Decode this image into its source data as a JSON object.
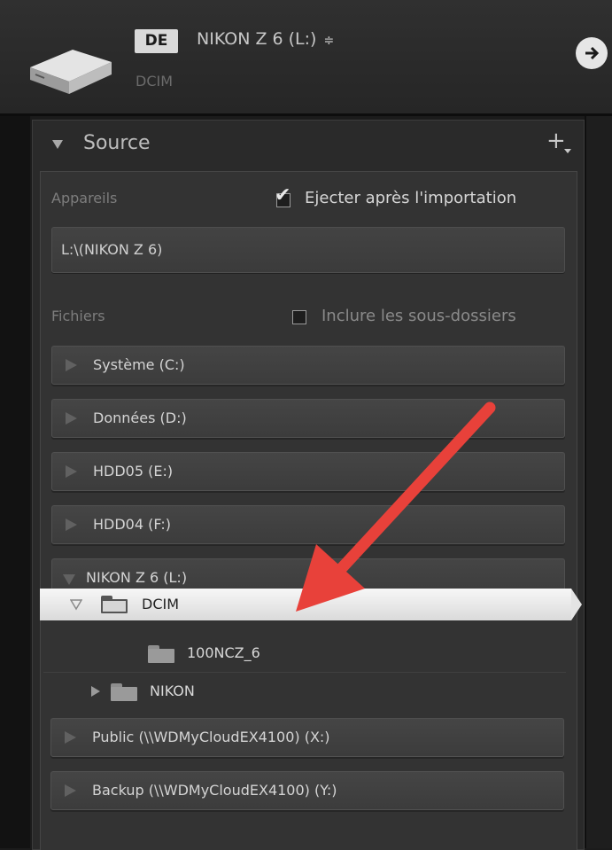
{
  "header": {
    "badge": "DE",
    "device_name": "NIKON Z 6 (L:)",
    "updown_glyph": "≑",
    "folder": "DCIM",
    "go_icon": "arrow-right-icon"
  },
  "source": {
    "title": "Source",
    "add_glyph": "+",
    "devices_label": "Appareils",
    "eject_label": "Ejecter après l'importation",
    "eject_checked": true,
    "path": "L:\\(NIKON Z 6)",
    "files_label": "Fichiers",
    "subfolders_label": "Inclure les sous-dossiers",
    "subfolders_checked": false,
    "drives": [
      {
        "label": "Système (C:)"
      },
      {
        "label": "Données (D:)"
      },
      {
        "label": "HDD05 (E:)"
      },
      {
        "label": "HDD04 (F:)"
      },
      {
        "label": "NIKON Z 6 (L:)",
        "expanded": true
      },
      {
        "label": "Public (\\\\WDMyCloudEX4100) (X:)"
      },
      {
        "label": "Backup (\\\\WDMyCloudEX4100) (Y:)"
      }
    ],
    "tree": {
      "selected_folder": "DCIM",
      "subfolder": "100NCZ_6",
      "sibling_folder": "NIKON"
    }
  },
  "colors": {
    "panel": "#2a2a2a",
    "selected_row": "#e8e8e8",
    "annotation_arrow": "#e8413a"
  }
}
